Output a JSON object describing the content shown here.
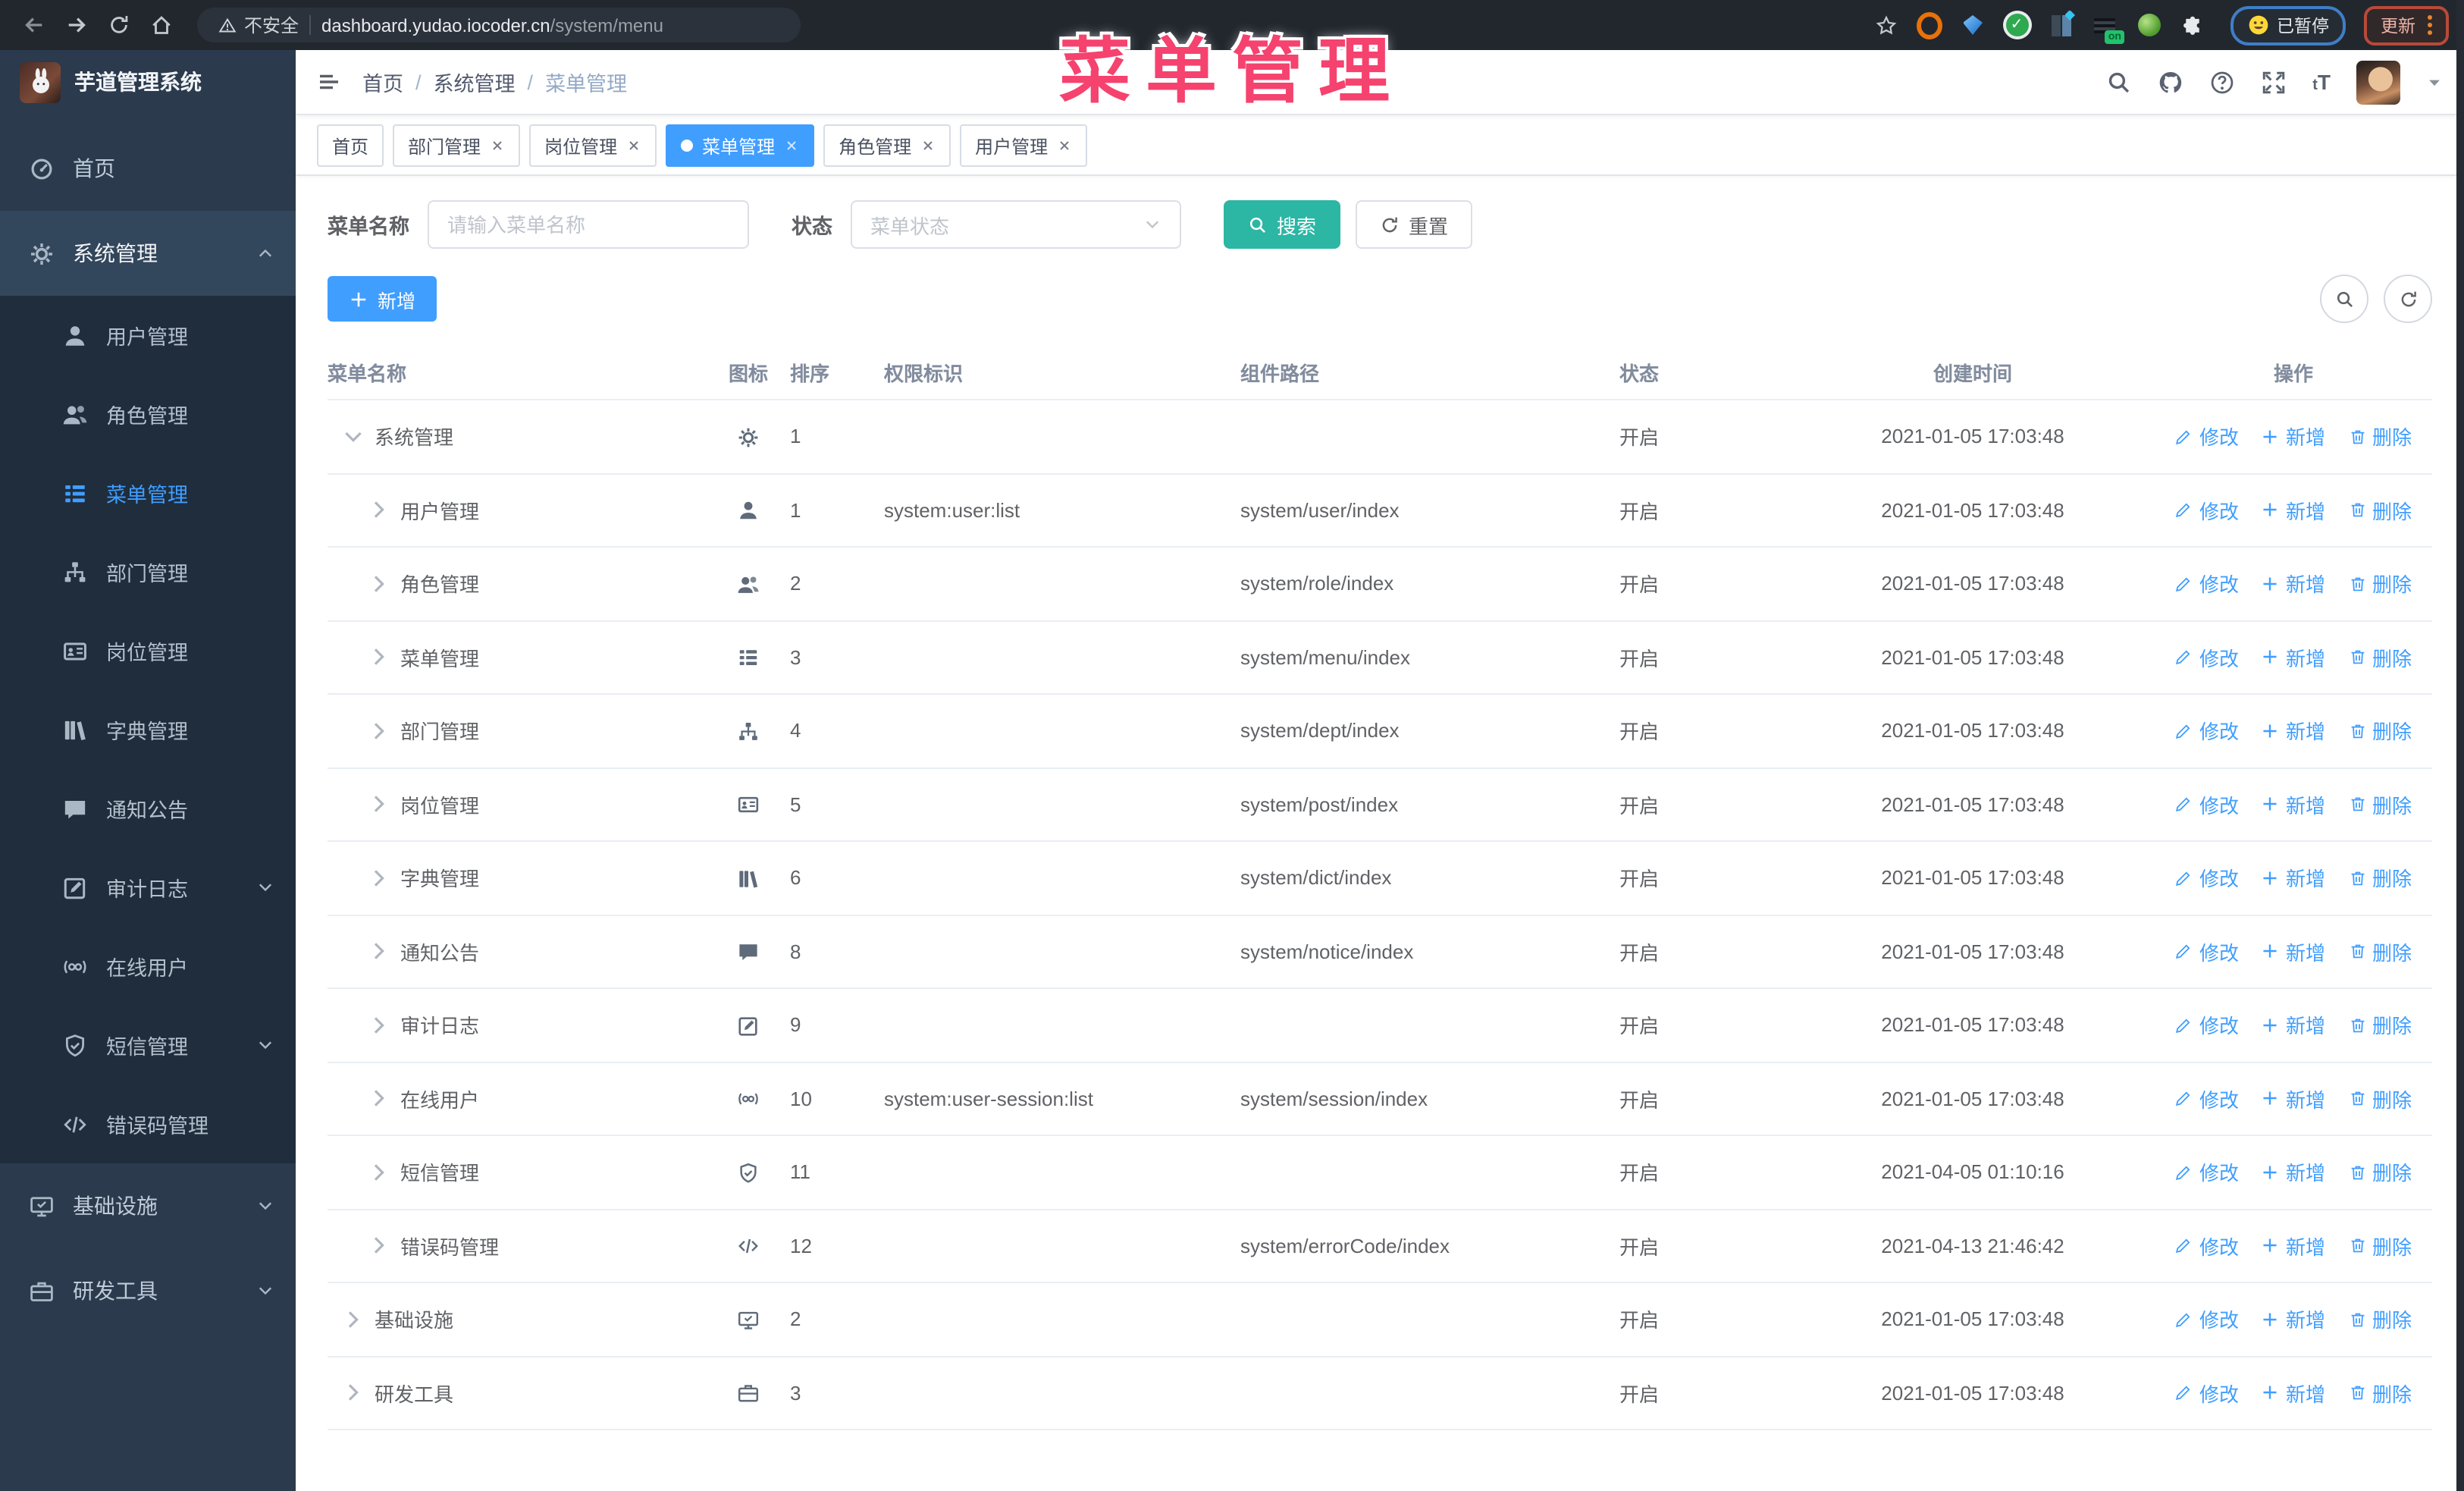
{
  "annotation": {
    "text": "菜单管理",
    "color": "#f5426e"
  },
  "browser": {
    "security_label": "不安全",
    "url_host": "dashboard.yudao.iocoder.cn",
    "url_path": "/system/menu",
    "paused_badge_label": "已暂停",
    "update_button_label": "更新"
  },
  "sidebar": {
    "title": "芋道管理系统",
    "items": [
      {
        "label": "首页",
        "icon": "gauge",
        "level": 0,
        "chevron": "",
        "active": false,
        "parent_active": false
      },
      {
        "label": "系统管理",
        "icon": "gear",
        "level": 0,
        "chevron": "up",
        "active": false,
        "parent_active": true
      },
      {
        "label": "用户管理",
        "icon": "user",
        "level": 1,
        "chevron": "",
        "active": false,
        "parent_active": false
      },
      {
        "label": "角色管理",
        "icon": "users",
        "level": 1,
        "chevron": "",
        "active": false,
        "parent_active": false
      },
      {
        "label": "菜单管理",
        "icon": "menu",
        "level": 1,
        "chevron": "",
        "active": true,
        "parent_active": false
      },
      {
        "label": "部门管理",
        "icon": "tree",
        "level": 1,
        "chevron": "",
        "active": false,
        "parent_active": false
      },
      {
        "label": "岗位管理",
        "icon": "idcard",
        "level": 1,
        "chevron": "",
        "active": false,
        "parent_active": false
      },
      {
        "label": "字典管理",
        "icon": "dict",
        "level": 1,
        "chevron": "",
        "active": false,
        "parent_active": false
      },
      {
        "label": "通知公告",
        "icon": "message",
        "level": 1,
        "chevron": "",
        "active": false,
        "parent_active": false
      },
      {
        "label": "审计日志",
        "icon": "edit",
        "level": 1,
        "chevron": "down",
        "active": false,
        "parent_active": false
      },
      {
        "label": "在线用户",
        "icon": "online",
        "level": 1,
        "chevron": "",
        "active": false,
        "parent_active": false
      },
      {
        "label": "短信管理",
        "icon": "shield",
        "level": 1,
        "chevron": "down",
        "active": false,
        "parent_active": false
      },
      {
        "label": "错误码管理",
        "icon": "code",
        "level": 1,
        "chevron": "",
        "active": false,
        "parent_active": false
      },
      {
        "label": "基础设施",
        "icon": "monitor",
        "level": 0,
        "chevron": "down",
        "active": false,
        "parent_active": false
      },
      {
        "label": "研发工具",
        "icon": "briefcase",
        "level": 0,
        "chevron": "down",
        "active": false,
        "parent_active": false
      }
    ]
  },
  "breadcrumb": {
    "items": [
      "首页",
      "系统管理",
      "菜单管理"
    ],
    "separator": "/"
  },
  "tabs": [
    {
      "label": "首页",
      "closable": false,
      "active": false
    },
    {
      "label": "部门管理",
      "closable": true,
      "active": false
    },
    {
      "label": "岗位管理",
      "closable": true,
      "active": false
    },
    {
      "label": "菜单管理",
      "closable": true,
      "active": true
    },
    {
      "label": "角色管理",
      "closable": true,
      "active": false
    },
    {
      "label": "用户管理",
      "closable": true,
      "active": false
    }
  ],
  "filters": {
    "name_label": "菜单名称",
    "name_placeholder": "请输入菜单名称",
    "name_value": "",
    "status_label": "状态",
    "status_placeholder": "菜单状态",
    "search_label": "搜索",
    "reset_label": "重置"
  },
  "toolbar": {
    "add_label": "新增"
  },
  "table": {
    "columns": [
      "菜单名称",
      "图标",
      "排序",
      "权限标识",
      "组件路径",
      "状态",
      "创建时间",
      "操作"
    ],
    "row_actions": [
      "修改",
      "新增",
      "删除"
    ],
    "rows": [
      {
        "name": "系统管理",
        "icon": "gear",
        "sort": "1",
        "perm": "",
        "path": "",
        "status": "开启",
        "time": "2021-01-05 17:03:48",
        "level": 0,
        "expanded": true
      },
      {
        "name": "用户管理",
        "icon": "user",
        "sort": "1",
        "perm": "system:user:list",
        "path": "system/user/index",
        "status": "开启",
        "time": "2021-01-05 17:03:48",
        "level": 1,
        "expanded": false
      },
      {
        "name": "角色管理",
        "icon": "users",
        "sort": "2",
        "perm": "",
        "path": "system/role/index",
        "status": "开启",
        "time": "2021-01-05 17:03:48",
        "level": 1,
        "expanded": false
      },
      {
        "name": "菜单管理",
        "icon": "menu",
        "sort": "3",
        "perm": "",
        "path": "system/menu/index",
        "status": "开启",
        "time": "2021-01-05 17:03:48",
        "level": 1,
        "expanded": false
      },
      {
        "name": "部门管理",
        "icon": "tree",
        "sort": "4",
        "perm": "",
        "path": "system/dept/index",
        "status": "开启",
        "time": "2021-01-05 17:03:48",
        "level": 1,
        "expanded": false
      },
      {
        "name": "岗位管理",
        "icon": "idcard",
        "sort": "5",
        "perm": "",
        "path": "system/post/index",
        "status": "开启",
        "time": "2021-01-05 17:03:48",
        "level": 1,
        "expanded": false
      },
      {
        "name": "字典管理",
        "icon": "dict",
        "sort": "6",
        "perm": "",
        "path": "system/dict/index",
        "status": "开启",
        "time": "2021-01-05 17:03:48",
        "level": 1,
        "expanded": false
      },
      {
        "name": "通知公告",
        "icon": "message",
        "sort": "8",
        "perm": "",
        "path": "system/notice/index",
        "status": "开启",
        "time": "2021-01-05 17:03:48",
        "level": 1,
        "expanded": false
      },
      {
        "name": "审计日志",
        "icon": "edit",
        "sort": "9",
        "perm": "",
        "path": "",
        "status": "开启",
        "time": "2021-01-05 17:03:48",
        "level": 1,
        "expanded": false
      },
      {
        "name": "在线用户",
        "icon": "online",
        "sort": "10",
        "perm": "system:user-session:list",
        "path": "system/session/index",
        "status": "开启",
        "time": "2021-01-05 17:03:48",
        "level": 1,
        "expanded": false
      },
      {
        "name": "短信管理",
        "icon": "shield",
        "sort": "11",
        "perm": "",
        "path": "",
        "status": "开启",
        "time": "2021-04-05 01:10:16",
        "level": 1,
        "expanded": false
      },
      {
        "name": "错误码管理",
        "icon": "code",
        "sort": "12",
        "perm": "",
        "path": "system/errorCode/index",
        "status": "开启",
        "time": "2021-04-13 21:46:42",
        "level": 1,
        "expanded": false
      },
      {
        "name": "基础设施",
        "icon": "monitor",
        "sort": "2",
        "perm": "",
        "path": "",
        "status": "开启",
        "time": "2021-01-05 17:03:48",
        "level": 0,
        "expanded": false
      },
      {
        "name": "研发工具",
        "icon": "briefcase",
        "sort": "3",
        "perm": "",
        "path": "",
        "status": "开启",
        "time": "2021-01-05 17:03:48",
        "level": 0,
        "expanded": false
      }
    ]
  },
  "colors": {
    "accent": "#409eff",
    "search_button": "#2cb6a4",
    "sidebar_bg": "#2b3a4d",
    "submenu_bg": "#1f2d3d",
    "annotation": "#f5426e"
  }
}
